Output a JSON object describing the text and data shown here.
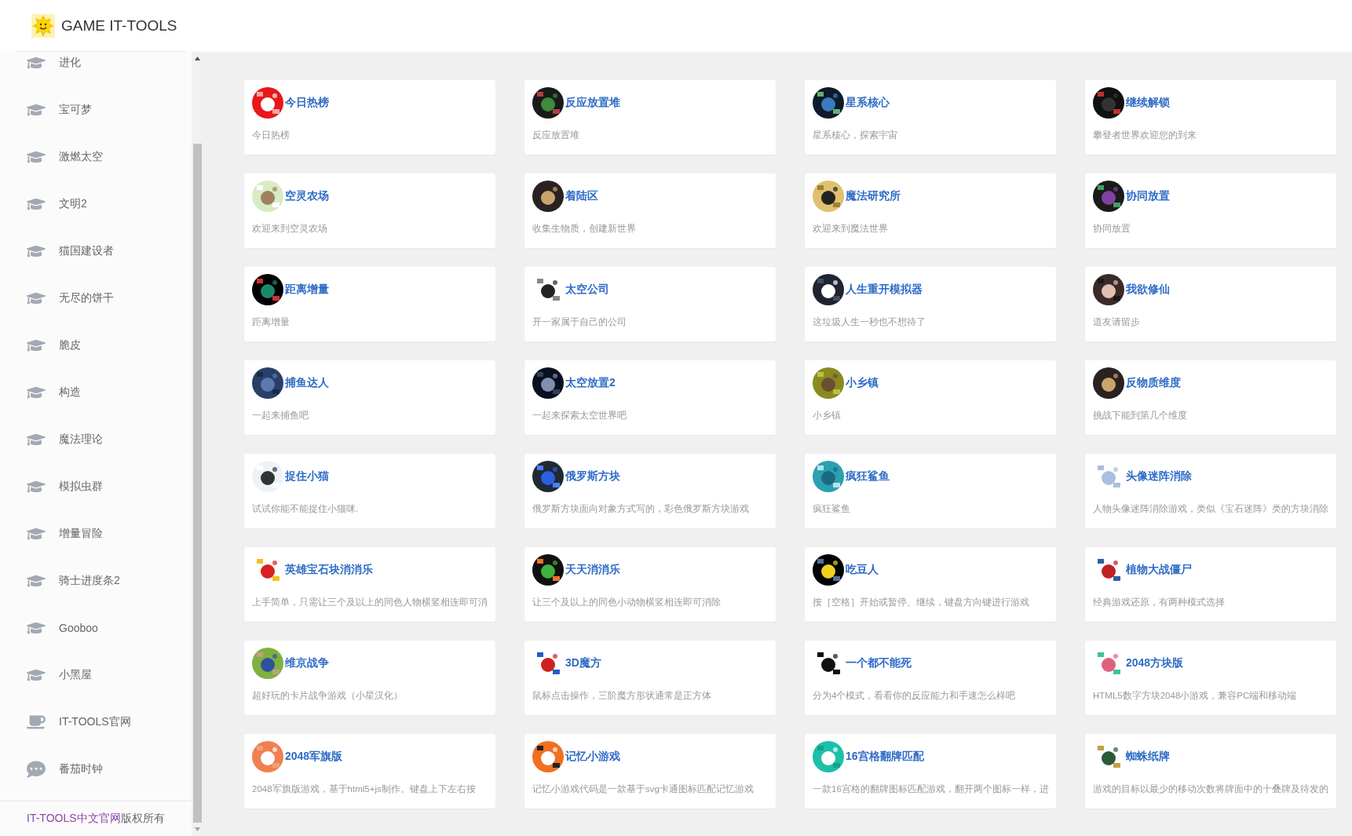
{
  "brand": {
    "title": "GAME IT-TOOLS"
  },
  "sidebar": {
    "items": [
      {
        "label": "进化",
        "kind": "cap"
      },
      {
        "label": "宝可梦",
        "kind": "cap"
      },
      {
        "label": "激燃太空",
        "kind": "cap"
      },
      {
        "label": "文明2",
        "kind": "cap"
      },
      {
        "label": "猫国建设者",
        "kind": "cap"
      },
      {
        "label": "无尽的饼干",
        "kind": "cap"
      },
      {
        "label": "脆皮",
        "kind": "cap"
      },
      {
        "label": "构造",
        "kind": "cap"
      },
      {
        "label": "魔法理论",
        "kind": "cap"
      },
      {
        "label": "模拟虫群",
        "kind": "cap"
      },
      {
        "label": "增量冒险",
        "kind": "cap"
      },
      {
        "label": "骑士进度条2",
        "kind": "cap"
      },
      {
        "label": "Gooboo",
        "kind": "cap"
      },
      {
        "label": "小黑屋",
        "kind": "cap"
      },
      {
        "label": "IT-TOOLS官网",
        "kind": "cup"
      },
      {
        "label": "番茄时钟",
        "kind": "chat"
      }
    ],
    "footer": {
      "link": "IT-TOOLS中文官网",
      "text": "版权所有"
    }
  },
  "cards": [
    {
      "title": "今日热榜",
      "description": "今日热榜"
    },
    {
      "title": "反应放置堆",
      "description": "反应放置堆"
    },
    {
      "title": "星系核心",
      "description": "星系核心，探索宇宙"
    },
    {
      "title": "继续解锁",
      "description": "攀登者世界欢迎您的到来"
    },
    {
      "title": "空灵农场",
      "description": "欢迎来到空灵农场"
    },
    {
      "title": "着陆区",
      "description": "收集生物质，创建新世界"
    },
    {
      "title": "魔法研究所",
      "description": "欢迎来到魔法世界"
    },
    {
      "title": "协同放置",
      "description": "协同放置"
    },
    {
      "title": "距离增量",
      "description": "距离增量"
    },
    {
      "title": "太空公司",
      "description": "开一家属于自己的公司"
    },
    {
      "title": "人生重开模拟器",
      "description": "这垃圾人生一秒也不想待了"
    },
    {
      "title": "我欲修仙",
      "description": "道友请留步"
    },
    {
      "title": "捕鱼达人",
      "description": "一起来捕鱼吧"
    },
    {
      "title": "太空放置2",
      "description": "一起来探索太空世界吧"
    },
    {
      "title": "小乡镇",
      "description": "小乡镇"
    },
    {
      "title": "反物质维度",
      "description": "挑战下能到第几个维度"
    },
    {
      "title": "捉住小猫",
      "description": "试试你能不能捉住小猫咪."
    },
    {
      "title": "俄罗斯方块",
      "description": "俄罗斯方块面向对象方式写的，彩色俄罗斯方块游戏"
    },
    {
      "title": "疯狂鲨鱼",
      "description": "疯狂鲨鱼"
    },
    {
      "title": "头像迷阵消除",
      "description": "人物头像迷阵消除游戏，类似《宝石迷阵》类的方块消除"
    },
    {
      "title": "英雄宝石块消消乐",
      "description": "上手简单，只需让三个及以上的同色人物横竖相连即可消"
    },
    {
      "title": "天天消消乐",
      "description": "让三个及以上的同色小动物横竖相连即可消除"
    },
    {
      "title": "吃豆人",
      "description": "按［空格］开始或暂停、继续，键盘方向键进行游戏"
    },
    {
      "title": "植物大战僵尸",
      "description": "经典游戏还原，有两种模式选择"
    },
    {
      "title": "维京战争",
      "description": "超好玩的卡片战争游戏（小星汉化）"
    },
    {
      "title": "3D魔方",
      "description": "鼠标点击操作，三阶魔方形状通常是正方体"
    },
    {
      "title": "一个都不能死",
      "description": "分为4个模式，看看你的反应能力和手速怎么样吧"
    },
    {
      "title": "2048方块版",
      "description": "HTML5数字方块2048小游戏，兼容PC端和移动端"
    },
    {
      "title": "2048军旗版",
      "description": "2048军旗版游戏，基于html5+js制作。键盘上下左右按"
    },
    {
      "title": "记忆小游戏",
      "description": "记忆小游戏代码是一款基于svg卡通图标匹配记忆游戏"
    },
    {
      "title": "16宫格翻牌匹配",
      "description": "一款16宫格的翻牌图标匹配游戏，翻开两个图标一样，进"
    },
    {
      "title": "蜘蛛纸牌",
      "description": "游戏的目标以最少的移动次数将牌面中的十叠牌及待发的"
    }
  ]
}
